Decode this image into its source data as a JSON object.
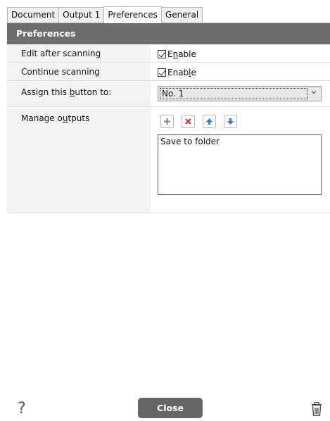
{
  "tabs": [
    {
      "label": "Document"
    },
    {
      "label": "Output 1"
    },
    {
      "label": "Preferences"
    },
    {
      "label": "General"
    }
  ],
  "section": {
    "title": "Preferences"
  },
  "rows": {
    "edit_after_scanning": {
      "label": "Edit after scanning",
      "checkbox_label_prefix": "E",
      "checkbox_label_mnemonic": "n",
      "checkbox_label_suffix": "able",
      "checked": true
    },
    "continue_scanning": {
      "label": "Continue scanning",
      "checkbox_label_prefix": "Enab",
      "checkbox_label_mnemonic": "l",
      "checkbox_label_suffix": "e",
      "checked": true
    },
    "assign_button": {
      "label_prefix": "Assign this ",
      "label_mnemonic": "b",
      "label_suffix": "utton to:",
      "selected": "No. 1"
    },
    "manage_outputs": {
      "label_prefix": "Manage o",
      "label_mnemonic": "u",
      "label_suffix": "tputs",
      "items": [
        "Save to folder"
      ]
    }
  },
  "toolbar_icons": [
    "plus-icon",
    "remove-icon",
    "move-up-icon",
    "move-down-icon"
  ],
  "footer": {
    "help_label": "?",
    "close_label": "Close"
  },
  "colors": {
    "header_bg": "#6d6d6d",
    "row_bg": "#f3f3f3",
    "close_bg": "#666666",
    "accent_blue": "#2a7de1",
    "remove_red": "#e0301e"
  }
}
